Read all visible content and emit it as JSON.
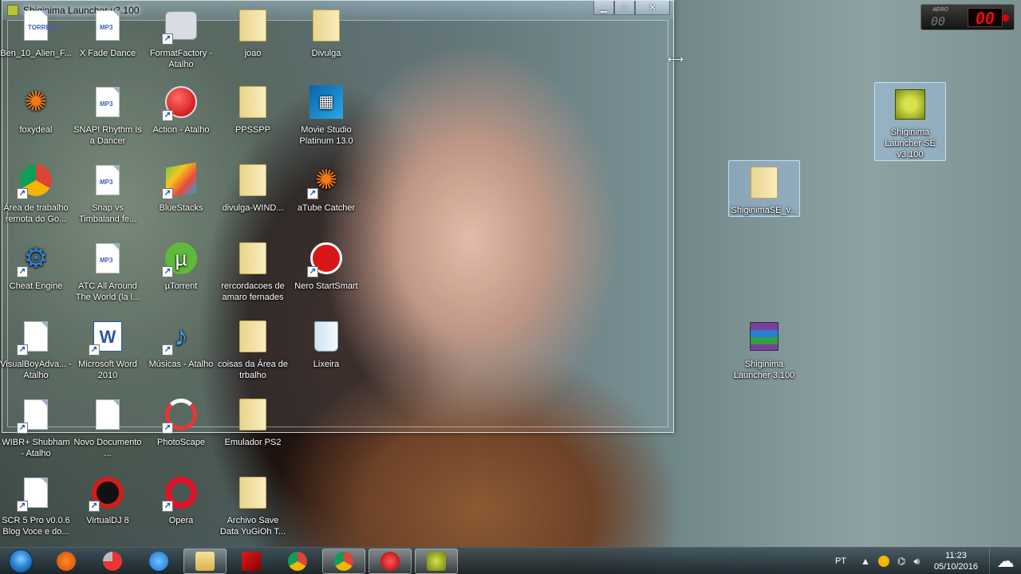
{
  "window": {
    "title": "Shiginima Launcher v3.100",
    "minimize": "▁",
    "maximize": "□",
    "close": "✕"
  },
  "icons": [
    {
      "label": "Ben_10_Alien_F...",
      "icon": "torrent-file-icon",
      "tag": "TORRENT"
    },
    {
      "label": "X Fade  Dance",
      "icon": "mp3-file-icon",
      "tag": "MP3"
    },
    {
      "label": "FormatFactory - Atalho",
      "icon": "formatfactory-icon"
    },
    {
      "label": "joao",
      "icon": "folder-icon"
    },
    {
      "label": "Divulga",
      "icon": "folder-icon"
    },
    {
      "label": "foxydeal",
      "icon": "foxydeal-icon"
    },
    {
      "label": "SNAP!  Rhythm Is a Dancer",
      "icon": "mp3-file-icon",
      "tag": "MP3"
    },
    {
      "label": "Action - Atalho",
      "icon": "action-icon"
    },
    {
      "label": "PPSSPP",
      "icon": "folder-icon"
    },
    {
      "label": "Movie Studio Platinum 13.0",
      "icon": "movie-studio-icon"
    },
    {
      "label": "Área de trabalho remota do Go...",
      "icon": "chrome-icon"
    },
    {
      "label": "Snap vs Timbaland fe...",
      "icon": "mp3-file-icon",
      "tag": "MP3"
    },
    {
      "label": "BlueStacks",
      "icon": "bluestacks-icon"
    },
    {
      "label": "divulga-WIND...",
      "icon": "folder-icon"
    },
    {
      "label": "aTube Catcher",
      "icon": "atube-catcher-icon"
    },
    {
      "label": "Cheat Engine",
      "icon": "cheat-engine-icon"
    },
    {
      "label": "ATC  All Around The World (la l...",
      "icon": "mp3-file-icon",
      "tag": "MP3"
    },
    {
      "label": "µTorrent",
      "icon": "utorrent-icon"
    },
    {
      "label": "rercordacoes  de amaro  fernades",
      "icon": "folder-icon"
    },
    {
      "label": "Nero StartSmart",
      "icon": "nero-icon"
    },
    {
      "label": "VisualBoyAdva... - Atalho",
      "icon": "blank-file-icon"
    },
    {
      "label": "Microsoft Word 2010",
      "icon": "word-icon"
    },
    {
      "label": "Músicas - Atalho",
      "icon": "music-icon"
    },
    {
      "label": "coisas da Área de trbalho",
      "icon": "folder-icon"
    },
    {
      "label": "Lixeira",
      "icon": "recycle-bin-icon"
    },
    {
      "label": "WIBR+ Shubham - Atalho",
      "icon": "blank-file-icon"
    },
    {
      "label": "Novo Documento ...",
      "icon": "text-document-icon"
    },
    {
      "label": "PhotoScape",
      "icon": "photoscape-icon"
    },
    {
      "label": "Emulador PS2",
      "icon": "folder-icon"
    },
    {
      "label": "SCR 5  Pro v0.0.6 Blog Voce e do...",
      "icon": "blank-file-icon"
    },
    {
      "label": "VirtualDJ 8",
      "icon": "virtualdj-icon"
    },
    {
      "label": "Opera",
      "icon": "opera-icon"
    },
    {
      "label": "Archivo  Save Data YuGiOh T...",
      "icon": "folder-icon"
    },
    {
      "label": "Shiginima Launcher SE v3.100",
      "icon": "minecraft-launcher-icon"
    },
    {
      "label": "ShiginimaSE_v...",
      "icon": "folder-icon"
    },
    {
      "label": "Shiginima Launcher 3.100",
      "icon": "winrar-icon"
    }
  ],
  "gadget": {
    "brand": "AERO",
    "left_digits": "00",
    "right_digits": "00"
  },
  "taskbar": {
    "apps": [
      {
        "name": "atube-catcher-icon"
      },
      {
        "name": "photoscape-icon"
      },
      {
        "name": "internet-explorer-icon"
      },
      {
        "name": "windows-explorer-icon"
      },
      {
        "name": "flash-icon"
      },
      {
        "name": "chrome-icon"
      },
      {
        "name": "chrome-remote-icon"
      },
      {
        "name": "action-icon"
      },
      {
        "name": "minecraft-launcher-icon"
      }
    ],
    "language": "PT",
    "time": "11:23",
    "date": "05/10/2016"
  },
  "colors": {
    "taskbar": "#1f2b30",
    "gadget_digits": "#e01010"
  }
}
